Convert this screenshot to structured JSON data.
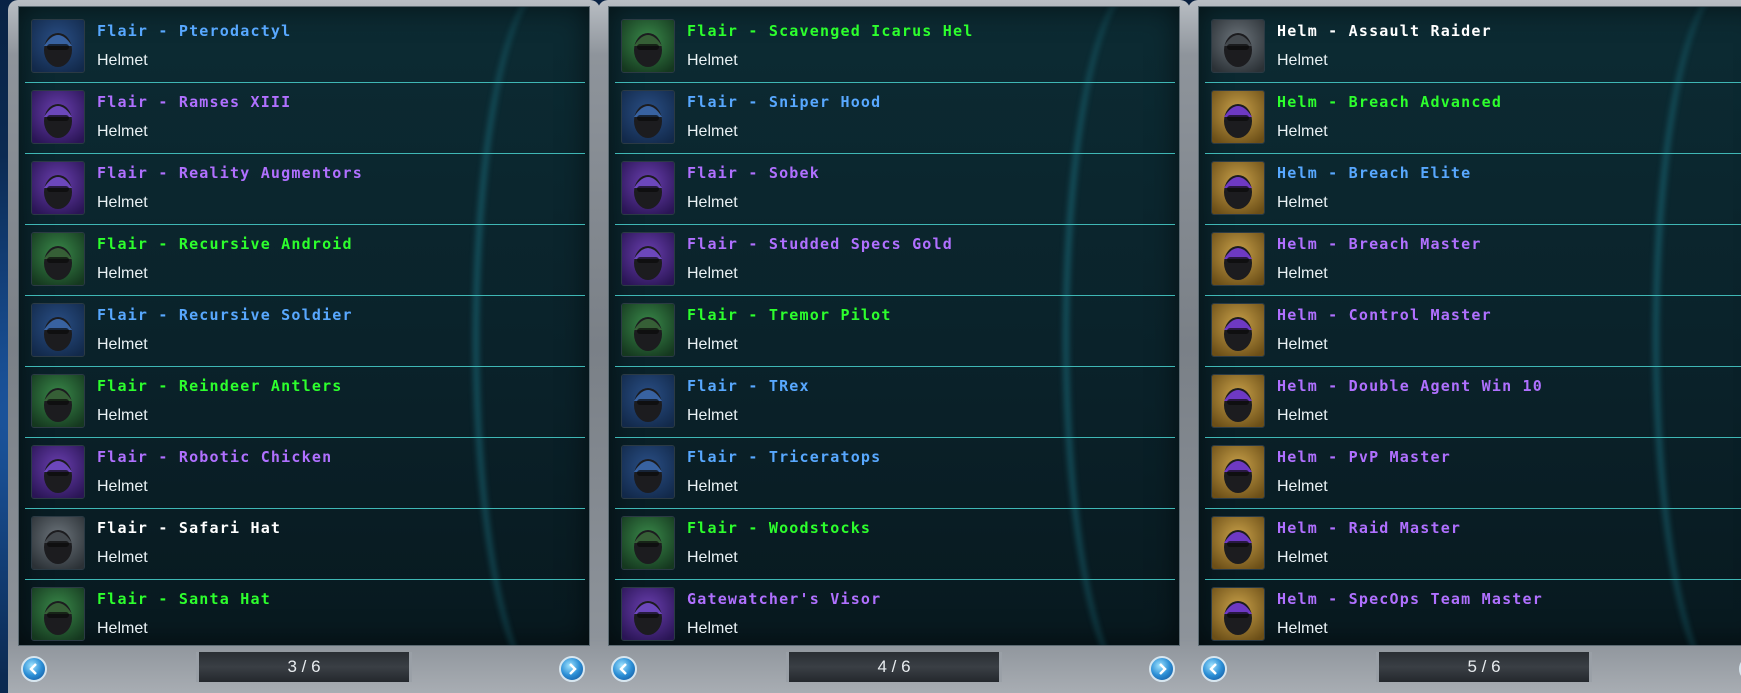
{
  "colors": {
    "green": "#2dff2d",
    "blue": "#58a8ff",
    "purple": "#b070ff",
    "white": "#ffffff",
    "row_divider": "#3fb7b5"
  },
  "panels": [
    {
      "page_label": "3 / 6",
      "items": [
        {
          "name": "Flair - Pterodactyl",
          "type": "Helmet",
          "rarity": "blue",
          "icon": "pterodactyl-icon",
          "icon_bg": "blue"
        },
        {
          "name": "Flair - Ramses XIII",
          "type": "Helmet",
          "rarity": "purple",
          "icon": "ramses-icon",
          "icon_bg": "purple"
        },
        {
          "name": "Flair - Reality Augmentors",
          "type": "Helmet",
          "rarity": "purple",
          "icon": "goggles-icon",
          "icon_bg": "purple"
        },
        {
          "name": "Flair - Recursive Android",
          "type": "Helmet",
          "rarity": "green",
          "icon": "android-icon",
          "icon_bg": "green"
        },
        {
          "name": "Flair - Recursive Soldier",
          "type": "Helmet",
          "rarity": "blue",
          "icon": "soldier-icon",
          "icon_bg": "blue"
        },
        {
          "name": "Flair - Reindeer Antlers",
          "type": "Helmet",
          "rarity": "green",
          "icon": "reindeer-icon",
          "icon_bg": "green"
        },
        {
          "name": "Flair - Robotic Chicken",
          "type": "Helmet",
          "rarity": "purple",
          "icon": "chicken-icon",
          "icon_bg": "purple"
        },
        {
          "name": "Flair - Safari Hat",
          "type": "Helmet",
          "rarity": "white",
          "icon": "safari-hat-icon",
          "icon_bg": "gray"
        },
        {
          "name": "Flair - Santa Hat",
          "type": "Helmet",
          "rarity": "green",
          "icon": "santa-hat-icon",
          "icon_bg": "green"
        }
      ]
    },
    {
      "page_label": "4 / 6",
      "items": [
        {
          "name": "Flair - Scavenged Icarus Hel",
          "type": "Helmet",
          "rarity": "green",
          "icon": "icarus-icon",
          "icon_bg": "green"
        },
        {
          "name": "Flair - Sniper Hood",
          "type": "Helmet",
          "rarity": "blue",
          "icon": "hood-icon",
          "icon_bg": "blue"
        },
        {
          "name": "Flair - Sobek",
          "type": "Helmet",
          "rarity": "purple",
          "icon": "sobek-icon",
          "icon_bg": "purple"
        },
        {
          "name": "Flair - Studded Specs Gold",
          "type": "Helmet",
          "rarity": "purple",
          "icon": "specs-icon",
          "icon_bg": "purple"
        },
        {
          "name": "Flair - Tremor Pilot",
          "type": "Helmet",
          "rarity": "green",
          "icon": "pilot-icon",
          "icon_bg": "green"
        },
        {
          "name": "Flair - TRex",
          "type": "Helmet",
          "rarity": "blue",
          "icon": "trex-icon",
          "icon_bg": "blue"
        },
        {
          "name": "Flair - Triceratops",
          "type": "Helmet",
          "rarity": "blue",
          "icon": "triceratops-icon",
          "icon_bg": "blue"
        },
        {
          "name": "Flair - Woodstocks",
          "type": "Helmet",
          "rarity": "green",
          "icon": "woodstocks-icon",
          "icon_bg": "green"
        },
        {
          "name": "Gatewatcher's Visor",
          "type": "Helmet",
          "rarity": "purple",
          "icon": "visor-icon",
          "icon_bg": "purple"
        }
      ]
    },
    {
      "page_label": "5 / 6",
      "items": [
        {
          "name": "Helm - Assault Raider",
          "type": "Helmet",
          "rarity": "white",
          "icon": "raider-helm-icon",
          "icon_bg": "gray"
        },
        {
          "name": "Helm - Breach Advanced",
          "type": "Helmet",
          "rarity": "green",
          "icon": "breach-helm-icon",
          "icon_bg": "gold"
        },
        {
          "name": "Helm - Breach Elite",
          "type": "Helmet",
          "rarity": "blue",
          "icon": "breach-helm-icon",
          "icon_bg": "gold"
        },
        {
          "name": "Helm - Breach Master",
          "type": "Helmet",
          "rarity": "purple",
          "icon": "breach-helm-icon",
          "icon_bg": "gold"
        },
        {
          "name": "Helm - Control Master",
          "type": "Helmet",
          "rarity": "purple",
          "icon": "control-helm-icon",
          "icon_bg": "gold"
        },
        {
          "name": "Helm - Double Agent Win 10",
          "type": "Helmet",
          "rarity": "purple",
          "icon": "agent-helm-icon",
          "icon_bg": "gold"
        },
        {
          "name": "Helm - PvP Master",
          "type": "Helmet",
          "rarity": "purple",
          "icon": "pvp-helm-icon",
          "icon_bg": "gold"
        },
        {
          "name": "Helm - Raid Master",
          "type": "Helmet",
          "rarity": "purple",
          "icon": "raid-helm-icon",
          "icon_bg": "gold"
        },
        {
          "name": "Helm - SpecOps Team Master",
          "type": "Helmet",
          "rarity": "purple",
          "icon": "specops-helm-icon",
          "icon_bg": "gold"
        }
      ]
    }
  ]
}
